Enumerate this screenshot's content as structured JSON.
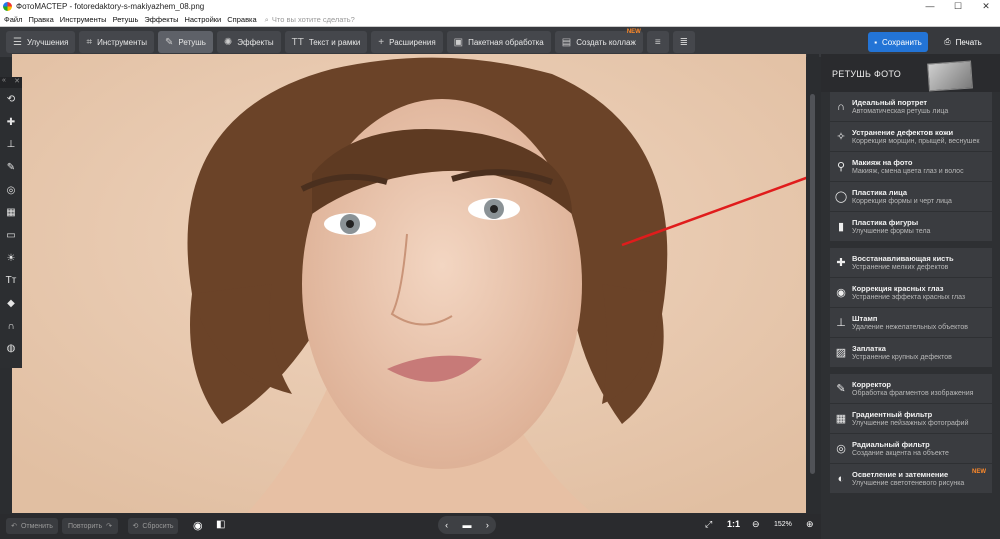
{
  "window": {
    "title": "ФотоМАСТЕР - fotoredaktory-s-makiyazhem_08.png",
    "min": "—",
    "max": "☐",
    "close": "✕"
  },
  "menu": {
    "items": [
      "Файл",
      "Правка",
      "Инструменты",
      "Ретушь",
      "Эффекты",
      "Настройки",
      "Справка"
    ],
    "search_placeholder": "Что вы хотите сделать?"
  },
  "toolbar": {
    "tabs": [
      "Улучшения",
      "Инструменты",
      "Ретушь",
      "Эффекты",
      "Текст и рамки",
      "Расширения"
    ],
    "active": "Ретушь",
    "batch": "Пакетная обработка",
    "collage": "Создать коллаж",
    "new_badge": "NEW",
    "save": "Сохранить",
    "print": "Печать"
  },
  "left_tools": [
    "swap",
    "patch",
    "stamp",
    "brush",
    "radial",
    "gradient",
    "rect",
    "sun",
    "text",
    "fill",
    "magnet",
    "bulb"
  ],
  "panel": {
    "title": "РЕТУШЬ ФОТО",
    "groups": [
      [
        {
          "icon": "portrait-icon",
          "title": "Идеальный портрет",
          "sub": "Автоматическая ретушь лица"
        },
        {
          "icon": "skin-icon",
          "title": "Устранение дефектов кожи",
          "sub": "Коррекция морщин, прыщей, веснушек"
        },
        {
          "icon": "makeup-icon",
          "title": "Макияж на фото",
          "sub": "Макияж, смена цвета глаз и волос"
        },
        {
          "icon": "face-icon",
          "title": "Пластика лица",
          "sub": "Коррекция формы и черт лица"
        },
        {
          "icon": "figure-icon",
          "title": "Пластика фигуры",
          "sub": "Улучшение формы тела"
        }
      ],
      [
        {
          "icon": "bandage-icon",
          "title": "Восстанавливающая кисть",
          "sub": "Устранение мелких дефектов"
        },
        {
          "icon": "eye-icon",
          "title": "Коррекция красных глаз",
          "sub": "Устранение эффекта красных глаз"
        },
        {
          "icon": "stamp-icon",
          "title": "Штамп",
          "sub": "Удаление нежелательных объектов"
        },
        {
          "icon": "patch-icon",
          "title": "Заплатка",
          "sub": "Устранение крупных дефектов"
        }
      ],
      [
        {
          "icon": "brush-icon",
          "title": "Корректор",
          "sub": "Обработка фрагментов изображения"
        },
        {
          "icon": "gradient-icon",
          "title": "Градиентный фильтр",
          "sub": "Улучшение пейзажных фотографий"
        },
        {
          "icon": "radial-icon",
          "title": "Радиальный фильтр",
          "sub": "Создание акцента на объекте"
        },
        {
          "icon": "dodge-icon",
          "title": "Осветление и затемнение",
          "sub": "Улучшение светотеневого рисунка",
          "badge": "NEW"
        }
      ]
    ]
  },
  "status": {
    "undo": "Отменить",
    "redo": "Повторить",
    "reset": "Сбросить",
    "ratio": "1:1",
    "zoom": "152%"
  },
  "colors": {
    "accent": "#2374d6",
    "new": "#ff8a2a",
    "arrow": "#e01c1c"
  }
}
